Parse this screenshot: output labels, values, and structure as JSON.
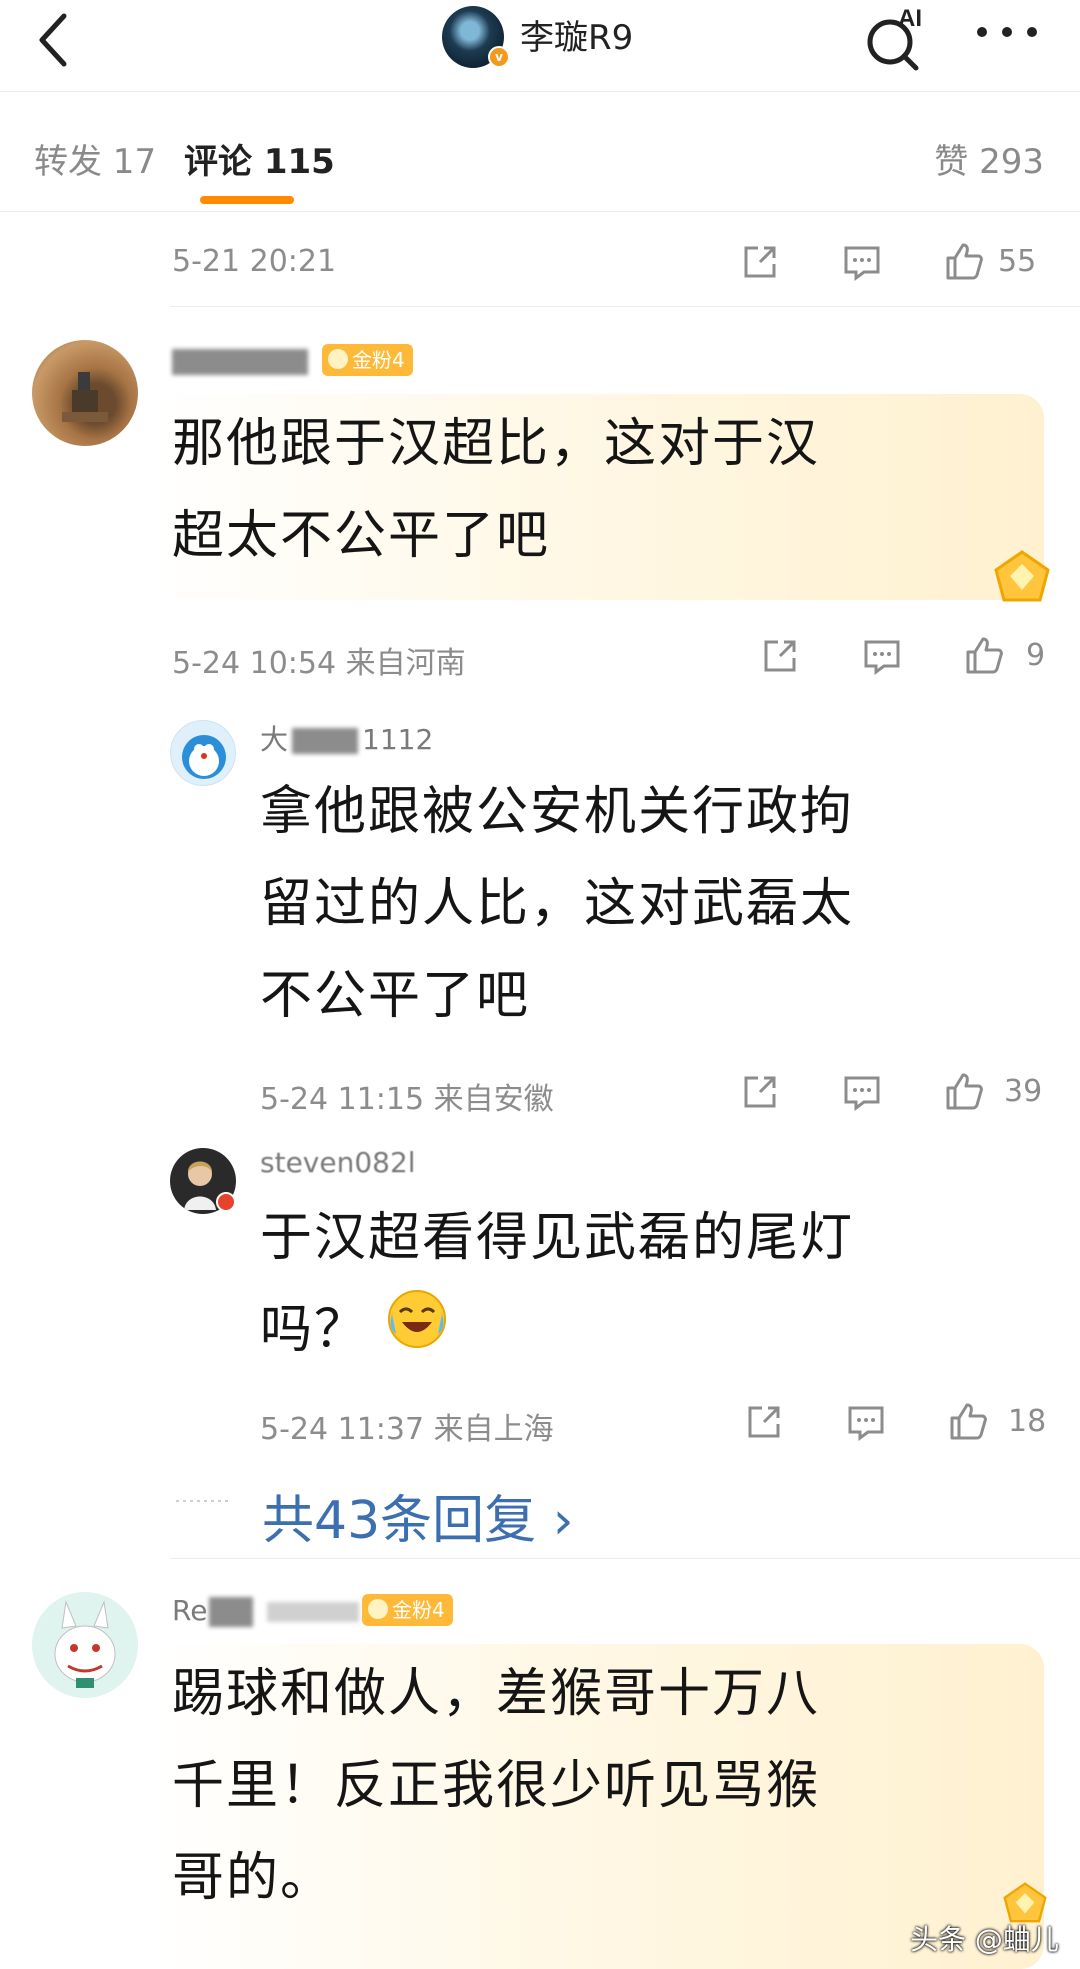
{
  "header": {
    "title": "李璇R9",
    "ai_label": "AI"
  },
  "tabs": {
    "repost": "转发 17",
    "comment": "评论 115",
    "like": "赞 293"
  },
  "post_meta": {
    "time": "5-21 20:21",
    "like_count": "55"
  },
  "comments": [
    {
      "username_visible": "",
      "badge": "金粉4",
      "text_line1": "那他跟于汉超比，这对于汉",
      "text_line2": "超太不公平了吧",
      "meta": "5-24 10:54  来自河南",
      "like_count": "9"
    }
  ],
  "replies": [
    {
      "username_visible_prefix": "大",
      "username_visible_suffix": "1112",
      "text_line1": "拿他跟被公安机关行政拘",
      "text_line2": "留过的人比，这对武磊太",
      "text_line3": "不公平了吧",
      "meta": "5-24 11:15  来自安徽",
      "like_count": "39"
    },
    {
      "username_visible": "steven082l",
      "text_line1": "于汉超看得见武磊的尾灯",
      "text_line2": "吗？",
      "meta": "5-24 11:37  来自上海",
      "like_count": "18"
    }
  ],
  "more_replies": "共43条回复 ›",
  "comment2": {
    "username_visible_prefix": "Re",
    "badge": "金粉4",
    "text_line1": "踢球和做人，差猴哥十万八",
    "text_line2": "千里！反正我很少听见骂猴",
    "text_line3": "哥的。"
  },
  "watermark": "头条 @蛐儿",
  "colors": {
    "accent": "#ff8a00",
    "link": "#3c6fb0",
    "badge": "#ffb938",
    "muted": "#8c8c8c"
  }
}
